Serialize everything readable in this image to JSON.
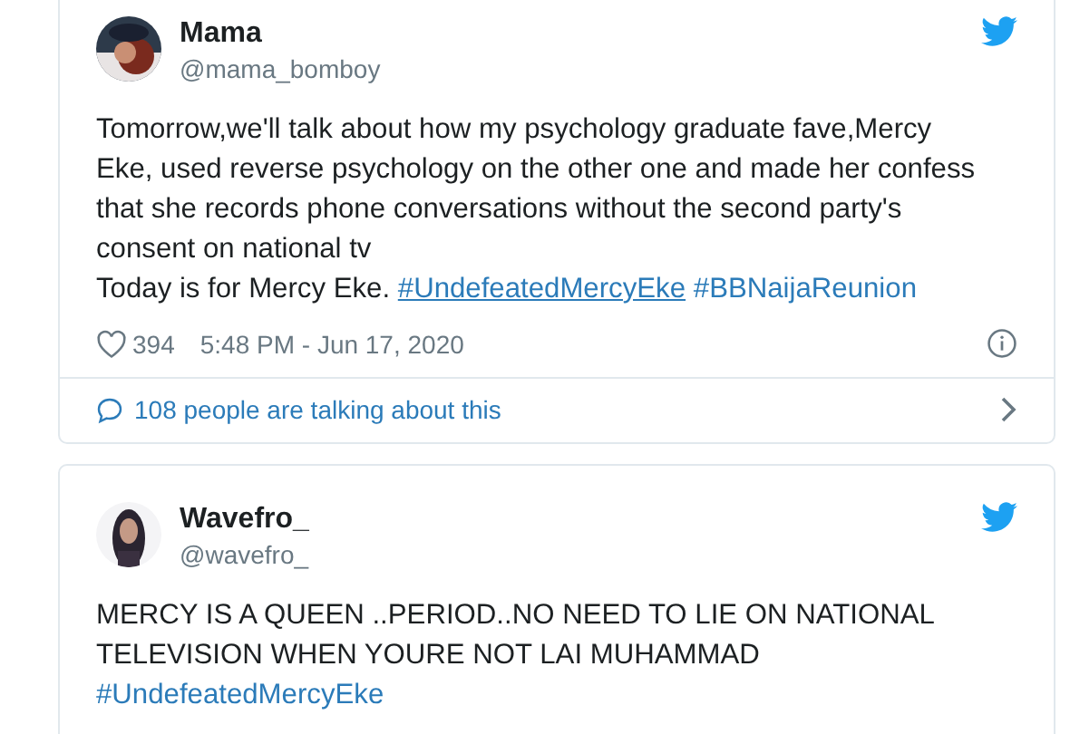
{
  "tweets": [
    {
      "name": "Mama",
      "handle": "@mama_bomboy",
      "lines": [
        [
          {
            "kind": "text",
            "text": "Tomorrow,we'll talk about how my psychology graduate fave,Mercy"
          }
        ],
        [
          {
            "kind": "text",
            "text": "Eke, used reverse psychology on the other one and made her confess"
          }
        ],
        [
          {
            "kind": "text",
            "text": "that she records phone conversations without the second party's"
          }
        ],
        [
          {
            "kind": "text",
            "text": "consent on national tv"
          }
        ],
        [
          {
            "kind": "text",
            "text": "Today is for Mercy Eke. "
          },
          {
            "kind": "hashtag",
            "text": "#UndefeatedMercyEke",
            "hovered": true
          },
          {
            "kind": "hashtag",
            "text": "#BBNaijaReunion",
            "hovered": false
          }
        ]
      ],
      "likes": "394",
      "time": "5:48 PM - Jun 17, 2020",
      "talking": "108 people are talking about this"
    },
    {
      "name": "Wavefro_",
      "handle": "@wavefro_",
      "lines": [
        [
          {
            "kind": "text",
            "text": "MERCY IS A QUEEN ..PERIOD..NO NEED TO LIE ON NATIONAL"
          }
        ],
        [
          {
            "kind": "text",
            "text": "TELEVISION WHEN YOURE NOT LAI MUHAMMAD"
          }
        ],
        [
          {
            "kind": "hashtag",
            "text": "#UndefeatedMercyEke",
            "hovered": false
          }
        ]
      ]
    }
  ]
}
